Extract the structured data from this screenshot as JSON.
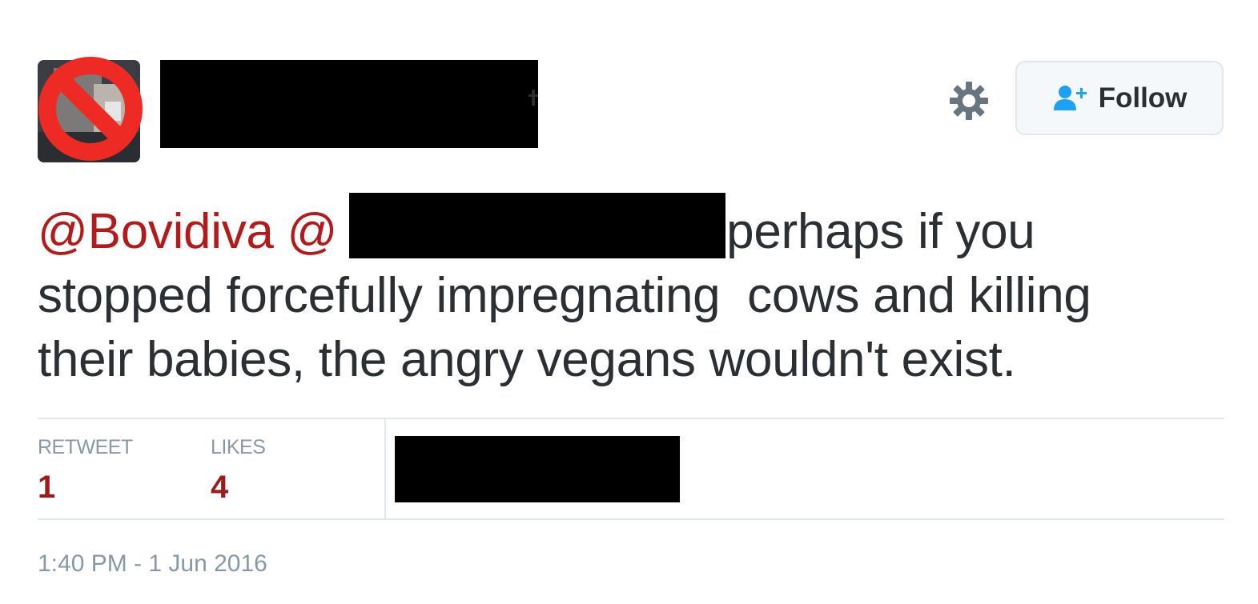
{
  "header": {
    "follow_label": "Follow",
    "icons": [
      "no-entry-avatar-overlay",
      "gear-icon",
      "add-user-icon"
    ]
  },
  "tweet": {
    "mention_1": "@Bovidiva",
    "mention_2": "@",
    "line_1_rest": "perhaps if you",
    "line_2": "stopped forcefully impregnating  cows and killing",
    "line_3": "their babies, the angry vegans wouldn't exist."
  },
  "stats": {
    "retweet_label": "RETWEET",
    "retweet_count": "1",
    "likes_label": "LIKES",
    "likes_count": "4"
  },
  "timestamp": "1:40 PM - 1 Jun 2016",
  "colors": {
    "mention": "#b31b1b",
    "count": "#9c1c1c",
    "meta_text": "#8899a6",
    "border": "#e1e8ed",
    "follow_icon": "#1da1f2"
  }
}
